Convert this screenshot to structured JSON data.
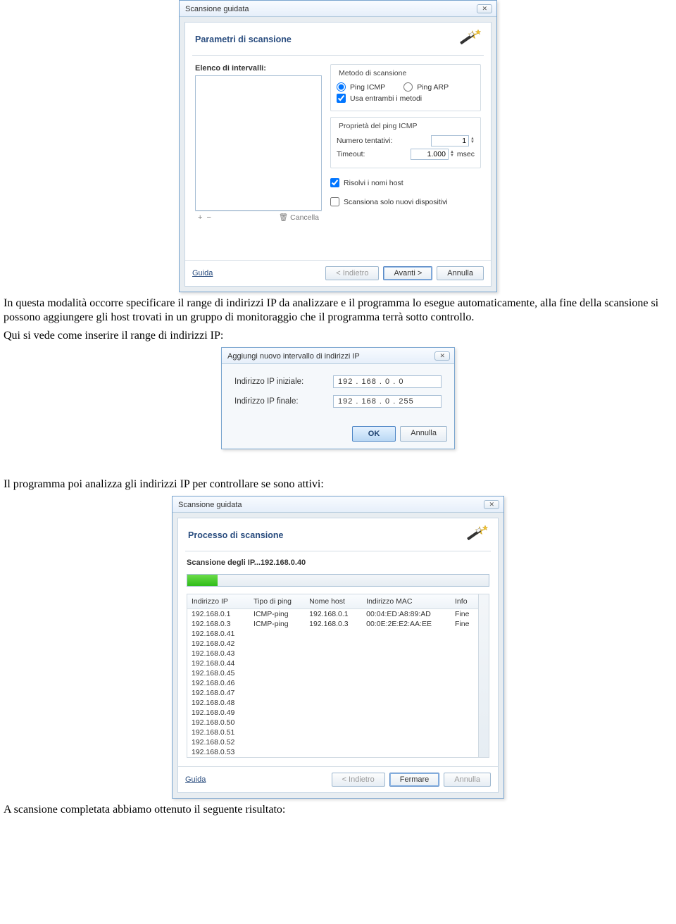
{
  "dialog1": {
    "window_title": "Scansione guidata",
    "header_title": "Parametri di scansione",
    "left": {
      "list_label": "Elenco di intervalli:",
      "plus": "+",
      "minus": "−",
      "trash_label": "Cancella"
    },
    "method_group": {
      "legend": "Metodo di scansione",
      "radio_icmp": "Ping ICMP",
      "radio_arp": "Ping ARP",
      "checkbox_both": "Usa entrambi i metodi"
    },
    "icmp_group": {
      "legend": "Proprietà del ping ICMP",
      "attempts_label": "Numero tentativi:",
      "attempts_value": "1",
      "timeout_label": "Timeout:",
      "timeout_value": "1.000",
      "timeout_unit": "msec"
    },
    "opts": {
      "resolve": "Risolvi i nomi host",
      "new_only": "Scansiona solo nuovi dispositivi"
    },
    "footer": {
      "help": "Guida",
      "back": "< Indietro",
      "next": "Avanti >",
      "cancel": "Annulla"
    }
  },
  "para1": "In questa modalità occorre specificare il range di indirizzi IP da analizzare e il programma lo esegue automaticamente, alla fine della scansione si possono aggiungere gli host trovati in un gruppo di monitoraggio che il programma terrà sotto controllo.",
  "para2": "Qui si vede come inserire il range di indirizzi IP:",
  "dialog2": {
    "title": "Aggiungi nuovo intervallo di indirizzi IP",
    "start_label": "Indirizzo IP iniziale:",
    "start_value": "192 . 168 .  0  .  0",
    "end_label": "Indirizzo IP finale:",
    "end_value": "192 . 168 .  0  . 255",
    "ok": "OK",
    "cancel": "Annulla"
  },
  "para3": "Il programma poi analizza gli indirizzi IP per controllare se sono attivi:",
  "dialog3": {
    "window_title": "Scansione guidata",
    "header_title": "Processo di scansione",
    "status_label": "Scansione degli IP...192.168.0.40",
    "columns": {
      "ip": "Indirizzo IP",
      "ping": "Tipo di ping",
      "host": "Nome host",
      "mac": "Indirizzo MAC",
      "info": "Info"
    },
    "rows": [
      {
        "ip": "192.168.0.1",
        "ping": "ICMP-ping",
        "host": "192.168.0.1",
        "mac": "00:04:ED:A8:89:AD",
        "info": "Fine"
      },
      {
        "ip": "192.168.0.3",
        "ping": "ICMP-ping",
        "host": "192.168.0.3",
        "mac": "00:0E:2E:E2:AA:EE",
        "info": "Fine"
      },
      {
        "ip": "192.168.0.41",
        "ping": "",
        "host": "",
        "mac": "",
        "info": ""
      },
      {
        "ip": "192.168.0.42",
        "ping": "",
        "host": "",
        "mac": "",
        "info": ""
      },
      {
        "ip": "192.168.0.43",
        "ping": "",
        "host": "",
        "mac": "",
        "info": ""
      },
      {
        "ip": "192.168.0.44",
        "ping": "",
        "host": "",
        "mac": "",
        "info": ""
      },
      {
        "ip": "192.168.0.45",
        "ping": "",
        "host": "",
        "mac": "",
        "info": ""
      },
      {
        "ip": "192.168.0.46",
        "ping": "",
        "host": "",
        "mac": "",
        "info": ""
      },
      {
        "ip": "192.168.0.47",
        "ping": "",
        "host": "",
        "mac": "",
        "info": ""
      },
      {
        "ip": "192.168.0.48",
        "ping": "",
        "host": "",
        "mac": "",
        "info": ""
      },
      {
        "ip": "192.168.0.49",
        "ping": "",
        "host": "",
        "mac": "",
        "info": ""
      },
      {
        "ip": "192.168.0.50",
        "ping": "",
        "host": "",
        "mac": "",
        "info": ""
      },
      {
        "ip": "192.168.0.51",
        "ping": "",
        "host": "",
        "mac": "",
        "info": ""
      },
      {
        "ip": "192.168.0.52",
        "ping": "",
        "host": "",
        "mac": "",
        "info": ""
      },
      {
        "ip": "192.168.0.53",
        "ping": "",
        "host": "",
        "mac": "",
        "info": ""
      }
    ],
    "footer": {
      "help": "Guida",
      "back": "< Indietro",
      "stop": "Fermare",
      "cancel": "Annulla"
    }
  },
  "para4": "A scansione completata abbiamo ottenuto il seguente risultato:"
}
